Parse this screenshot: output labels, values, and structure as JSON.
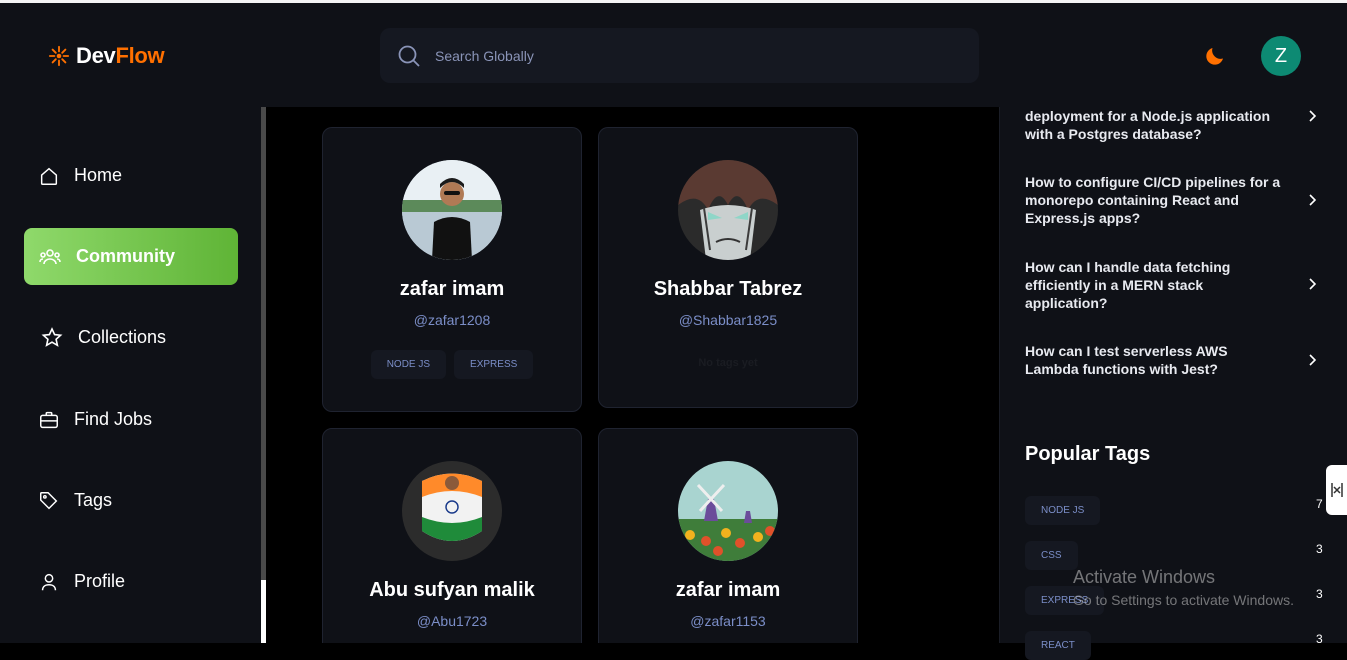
{
  "app": {
    "logo_dev": "Dev",
    "logo_flow": "Flow"
  },
  "search": {
    "placeholder": "Search Globally"
  },
  "user": {
    "initial": "Z"
  },
  "sidebar": {
    "items": [
      {
        "label": "Home",
        "icon": "home-icon"
      },
      {
        "label": "Community",
        "icon": "users-icon",
        "active": true
      },
      {
        "label": "Collections",
        "icon": "star-icon"
      },
      {
        "label": "Find Jobs",
        "icon": "suitcase-icon"
      },
      {
        "label": "Tags",
        "icon": "tag-icon"
      },
      {
        "label": "Profile",
        "icon": "user-icon"
      }
    ]
  },
  "community": {
    "users": [
      {
        "name": "zafar imam",
        "handle": "@zafar1208",
        "tags": [
          "NODE JS",
          "EXPRESS"
        ]
      },
      {
        "name": "Shabbar Tabrez",
        "handle": "@Shabbar1825",
        "no_tags": "No tags yet"
      },
      {
        "name": "Abu sufyan malik",
        "handle": "@Abu1723"
      },
      {
        "name": "zafar imam",
        "handle": "@zafar1153"
      }
    ]
  },
  "right_sidebar": {
    "questions": [
      {
        "text": "deployment for a Node.js application with a Postgres database?"
      },
      {
        "text": "How to configure CI/CD pipelines for a monorepo containing React and Express.js apps?"
      },
      {
        "text": "How can I handle data fetching efficiently in a MERN stack application?"
      },
      {
        "text": "How can I test serverless AWS Lambda functions with Jest?"
      }
    ],
    "popular_title": "Popular Tags",
    "popular_tags": [
      {
        "name": "NODE JS",
        "count": "7"
      },
      {
        "name": "CSS",
        "count": "3"
      },
      {
        "name": "EXPRESS",
        "count": "3"
      },
      {
        "name": "REACT",
        "count": "3"
      }
    ]
  },
  "watermark": {
    "line1": "Activate Windows",
    "line2": "Go to Settings to activate Windows."
  },
  "colors": {
    "accent": "#ff7000",
    "active_start": "#8fd96b",
    "active_end": "#5fb436",
    "avatar": "#0d8a73"
  }
}
